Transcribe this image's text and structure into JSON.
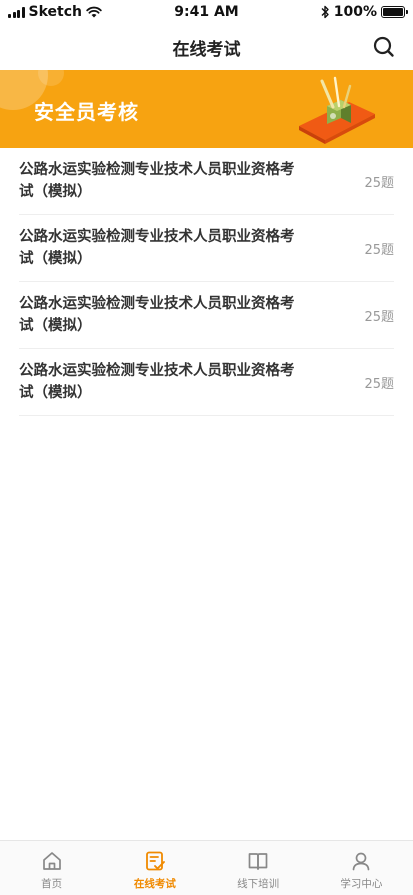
{
  "status_bar": {
    "carrier": "Sketch",
    "time": "9:41 AM",
    "battery": "100%",
    "battery_level": 1.0
  },
  "header": {
    "title": "在线考试"
  },
  "banner": {
    "title": "安全员考核"
  },
  "exams": [
    {
      "name": "公路水运实验检测专业技术人员职业资格考试（模拟）",
      "count": "25题"
    },
    {
      "name": "公路水运实验检测专业技术人员职业资格考试（模拟）",
      "count": "25题"
    },
    {
      "name": "公路水运实验检测专业技术人员职业资格考试（模拟）",
      "count": "25题"
    },
    {
      "name": "公路水运实验检测专业技术人员职业资格考试（模拟）",
      "count": "25题"
    }
  ],
  "tabs": [
    {
      "label": "首页",
      "icon": "home-icon",
      "active": false
    },
    {
      "label": "在线考试",
      "icon": "exam-icon",
      "active": true
    },
    {
      "label": "线下培训",
      "icon": "book-icon",
      "active": false
    },
    {
      "label": "学习中心",
      "icon": "user-icon",
      "active": false
    }
  ],
  "colors": {
    "accent": "#f7a311",
    "tab_active": "#f08a00",
    "tab_inactive": "#888888"
  }
}
